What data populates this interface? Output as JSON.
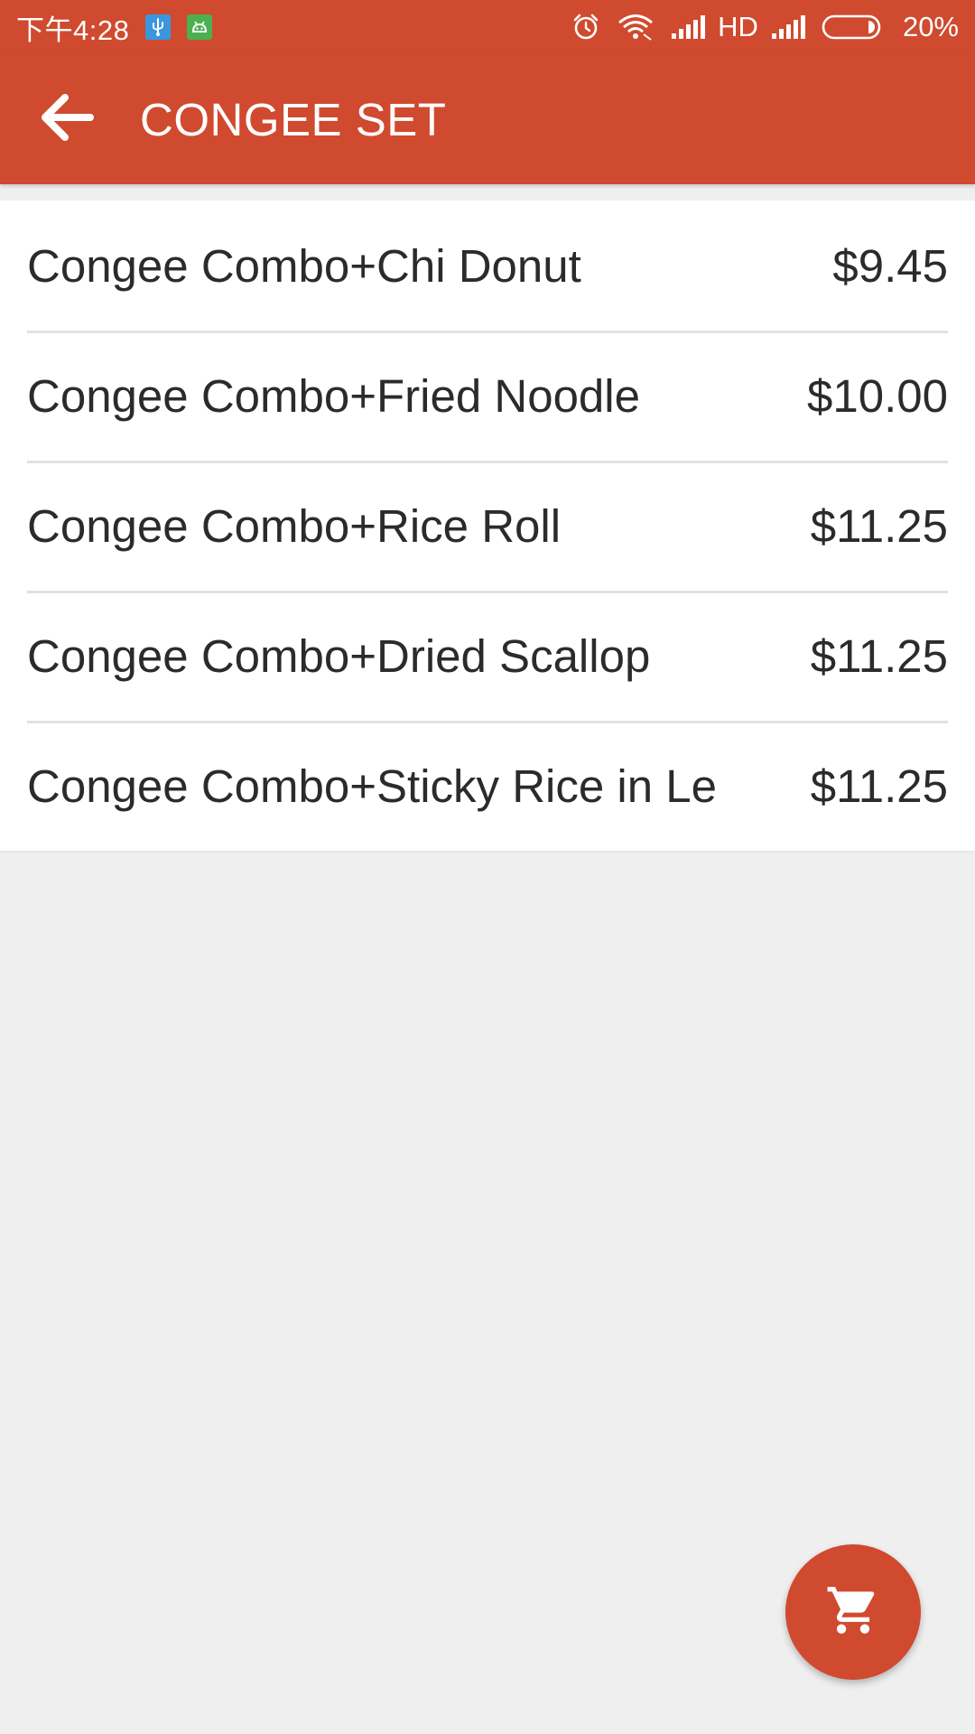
{
  "status_bar": {
    "time": "下午4:28",
    "network_label": "HD",
    "battery": "20%",
    "icons": [
      "usb-icon",
      "android-debug-icon",
      "alarm-icon",
      "wifi-icon",
      "signal-icon",
      "signal-icon",
      "battery-icon"
    ]
  },
  "app_bar": {
    "title": "CONGEE SET",
    "back_icon": "arrow-back-icon"
  },
  "menu": {
    "items": [
      {
        "name": "Congee Combo+Chi Donut",
        "price": "$9.45"
      },
      {
        "name": "Congee Combo+Fried Noodle",
        "price": "$10.00"
      },
      {
        "name": "Congee Combo+Rice Roll",
        "price": "$11.25"
      },
      {
        "name": "Congee Combo+Dried Scallop",
        "price": "$11.25"
      },
      {
        "name": "Congee Combo+Sticky Rice in Le",
        "price": "$11.25"
      }
    ]
  },
  "fab": {
    "icon": "shopping-cart-icon"
  },
  "colors": {
    "primary": "#d04a2f",
    "background": "#efefef",
    "list_background": "#ffffff",
    "text": "#2b2b2b",
    "divider": "#e2e2e2",
    "usb_badge": "#3a96dd",
    "android_badge": "#4caf50"
  }
}
